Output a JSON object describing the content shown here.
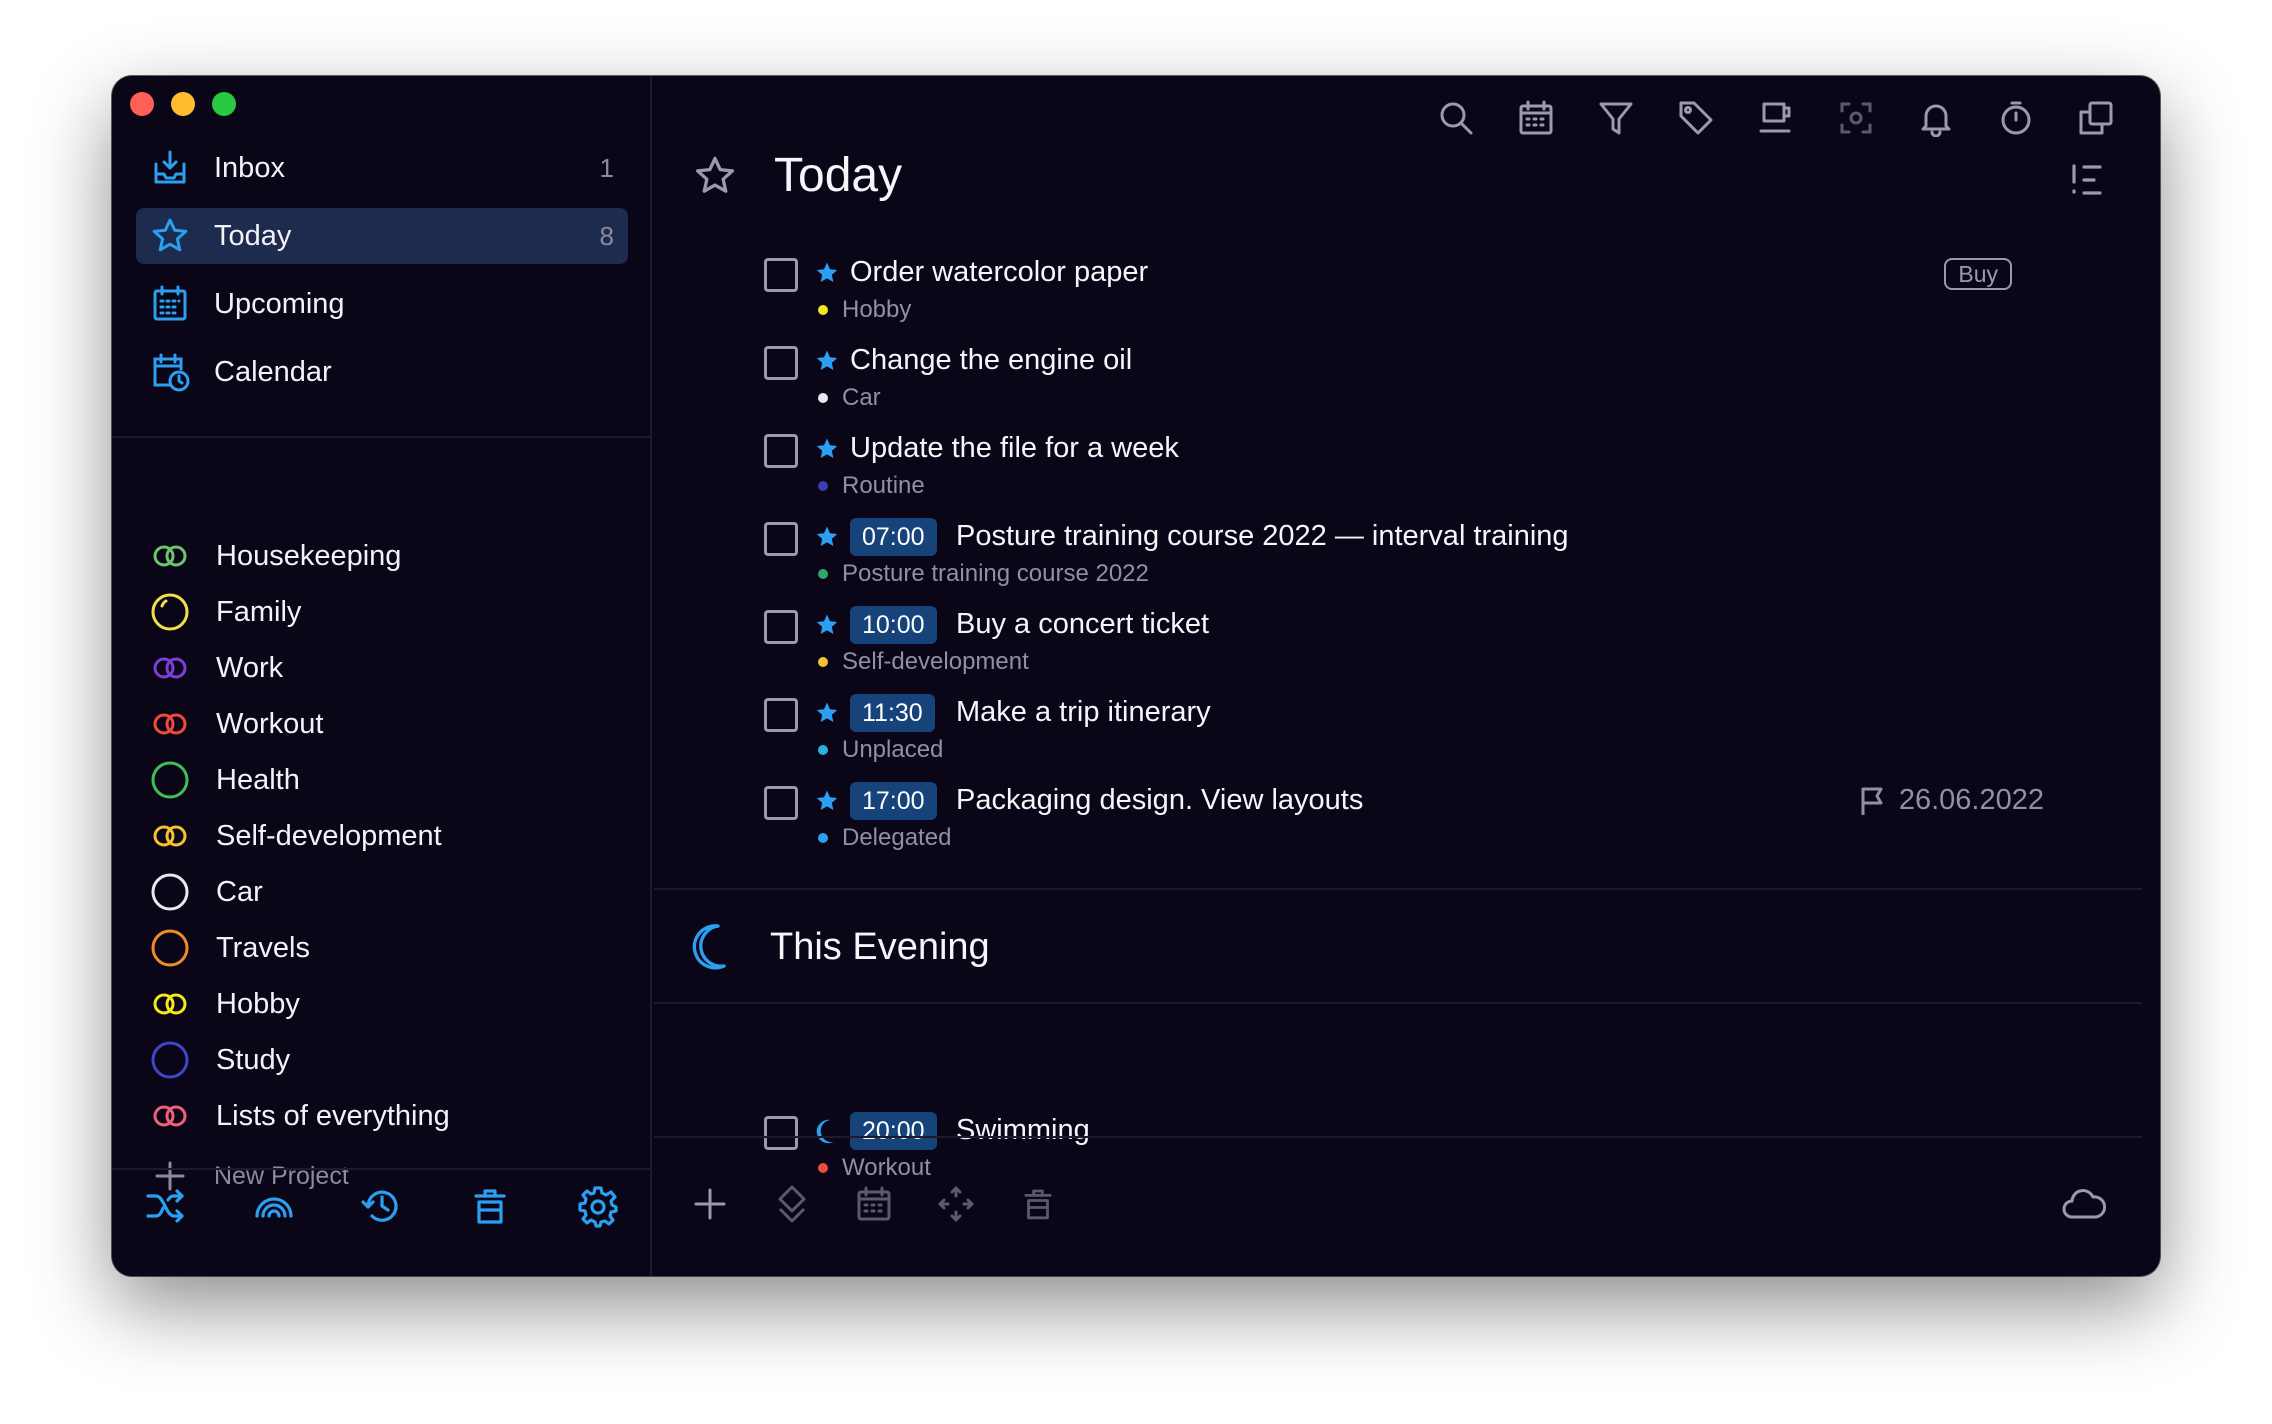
{
  "colors": {
    "accent": "#2b9ff0",
    "window_bg": "#0a0618",
    "active_bg": "#1d2b4f",
    "time_badge": "#15437a",
    "muted": "#8f8fa6"
  },
  "sidebar": {
    "nav": [
      {
        "label": "Inbox",
        "count": "1",
        "icon": "inbox-icon"
      },
      {
        "label": "Today",
        "count": "8",
        "icon": "star-icon"
      },
      {
        "label": "Upcoming",
        "count": "",
        "icon": "calendar-grid-icon"
      },
      {
        "label": "Calendar",
        "count": "",
        "icon": "calendar-clock-icon"
      }
    ],
    "projects": [
      {
        "label": "Housekeeping",
        "color": "#6cc46c",
        "icon": "double-ring-icon"
      },
      {
        "label": "Family",
        "color": "#f2e04a",
        "icon": "ring-icon"
      },
      {
        "label": "Work",
        "color": "#7b3fd6",
        "icon": "double-ring-icon"
      },
      {
        "label": "Workout",
        "color": "#ef4a3c",
        "icon": "double-ring-icon"
      },
      {
        "label": "Health",
        "color": "#3fbf5a",
        "icon": "ring-icon"
      },
      {
        "label": "Self-development",
        "color": "#f5c12e",
        "icon": "double-ring-icon"
      },
      {
        "label": "Car",
        "color": "#e8e8f0",
        "icon": "ring-icon"
      },
      {
        "label": "Travels",
        "color": "#f08a2a",
        "icon": "ring-icon"
      },
      {
        "label": "Hobby",
        "color": "#f2e81a",
        "icon": "double-ring-icon"
      },
      {
        "label": "Study",
        "color": "#4046c8",
        "icon": "ring-icon"
      },
      {
        "label": "Lists of everything",
        "color": "#f0607a",
        "icon": "double-ring-icon"
      }
    ],
    "new_project_label": "New Project",
    "bottom_icons": [
      "shuffle-icon",
      "rainbow-icon",
      "history-icon",
      "trash-icon",
      "settings-icon"
    ]
  },
  "main": {
    "title": "Today",
    "toolbar_icons": [
      "search-icon",
      "calendar-icon",
      "filter-icon",
      "tag-icon",
      "coffee-icon",
      "focus-icon",
      "bell-icon",
      "timer-icon",
      "copy-icon"
    ],
    "tasks": [
      {
        "title": "Order watercolor paper",
        "project": "Hobby",
        "dot": "#f2e81a",
        "time": "",
        "tag": "Buy",
        "deadline": ""
      },
      {
        "title": "Change the engine oil",
        "project": "Car",
        "dot": "#e8e8f0",
        "time": "",
        "tag": "",
        "deadline": ""
      },
      {
        "title": "Update the file for a week",
        "project": "Routine",
        "dot": "#3a3fb0",
        "time": "",
        "tag": "",
        "deadline": ""
      },
      {
        "title": "Posture training course 2022 — interval training",
        "project": "Posture training course 2022",
        "dot": "#2ba86a",
        "time": "07:00",
        "tag": "",
        "deadline": ""
      },
      {
        "title": "Buy a concert ticket",
        "project": "Self-development",
        "dot": "#f5c12e",
        "time": "10:00",
        "tag": "",
        "deadline": ""
      },
      {
        "title": "Make a trip itinerary",
        "project": "Unplaced",
        "dot": "#2ab0e0",
        "time": "11:30",
        "tag": "",
        "deadline": ""
      },
      {
        "title": "Packaging design. View layouts",
        "project": "Delegated",
        "dot": "#2b9ff0",
        "time": "17:00",
        "tag": "",
        "deadline": "26.06.2022"
      }
    ],
    "evening_title": "This Evening",
    "evening_tasks": [
      {
        "title": "Swimming",
        "project": "Workout",
        "dot": "#ef4a3c",
        "time": "20:00"
      }
    ],
    "bottom_icons": [
      "plus-icon",
      "priority-icon",
      "calendar-icon",
      "move-icon",
      "trash-icon",
      "cloud-icon"
    ]
  }
}
